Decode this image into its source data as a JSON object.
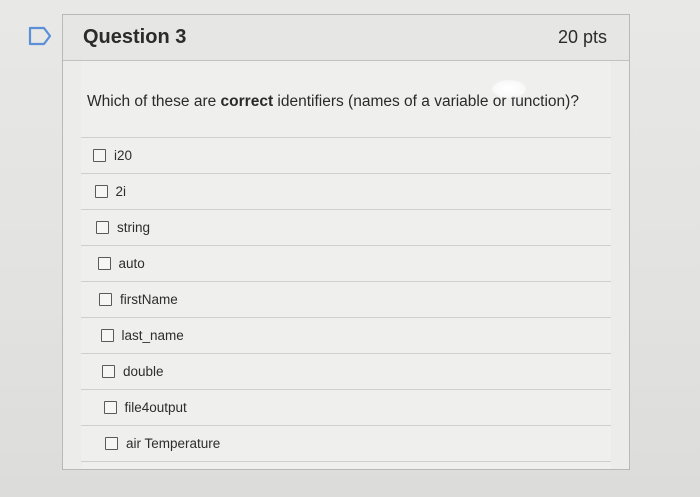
{
  "question": {
    "title": "Question 3",
    "points": "20 pts",
    "prompt_before": "Which of these are ",
    "prompt_bold": "correct",
    "prompt_after": " identifiers (names of a variable or function)?"
  },
  "options": [
    {
      "label": "i20",
      "checked": false
    },
    {
      "label": "2i",
      "checked": false
    },
    {
      "label": "string",
      "checked": false
    },
    {
      "label": "auto",
      "checked": false
    },
    {
      "label": "firstName",
      "checked": false
    },
    {
      "label": "last_name",
      "checked": false
    },
    {
      "label": "double",
      "checked": false
    },
    {
      "label": "file4output",
      "checked": false
    },
    {
      "label": "air Temperature",
      "checked": false
    }
  ],
  "icons": {
    "flag": "flag-icon",
    "checkbox": "checkbox-icon"
  },
  "colors": {
    "flag_stroke": "#5b8fd8",
    "border": "#b9b9b7"
  }
}
